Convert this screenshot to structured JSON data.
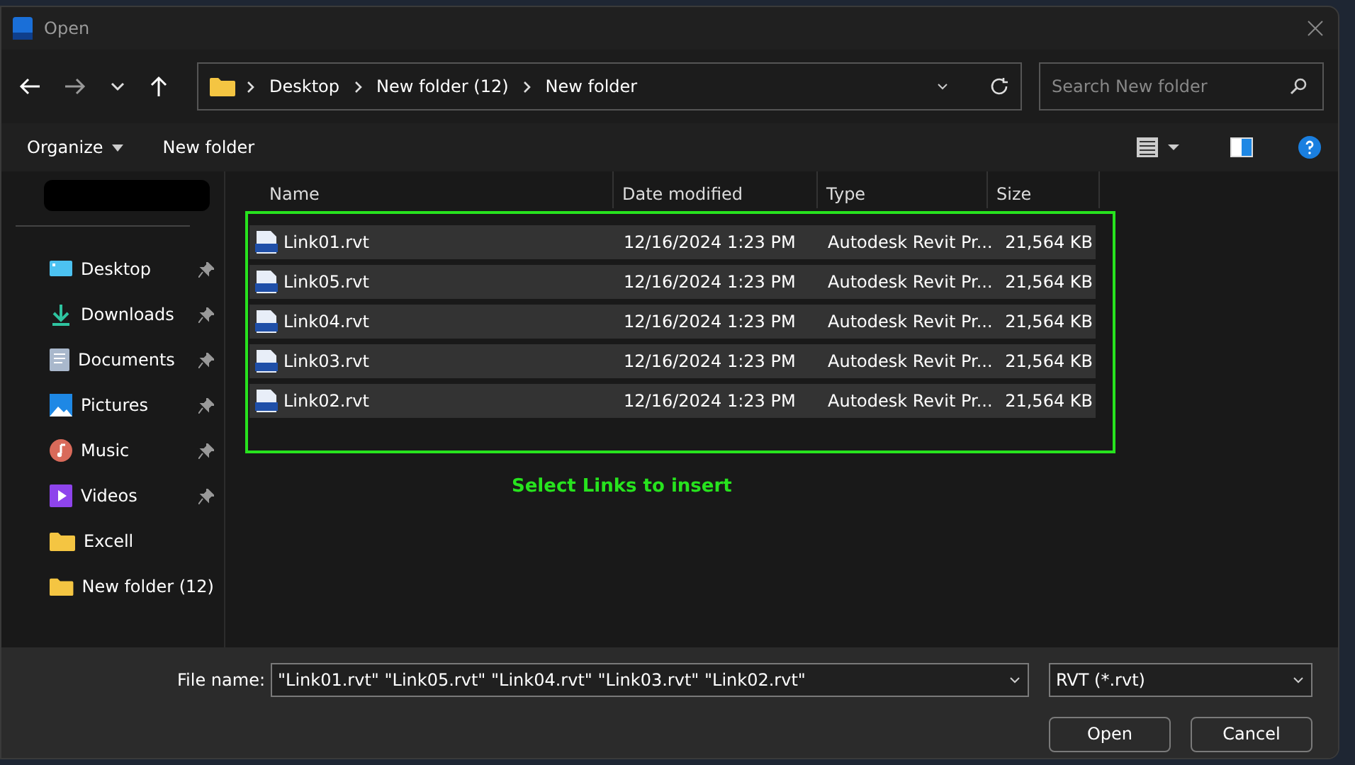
{
  "window": {
    "title": "Open"
  },
  "nav": {
    "path": [
      "Desktop",
      "New folder (12)",
      "New folder"
    ],
    "search": {
      "placeholder": "Search New folder"
    }
  },
  "toolbar": {
    "organize": "Organize",
    "new_folder": "New folder"
  },
  "sidebar": {
    "items": [
      {
        "label": "Desktop",
        "kind": "desktop",
        "pinned": true
      },
      {
        "label": "Downloads",
        "kind": "downloads",
        "pinned": true
      },
      {
        "label": "Documents",
        "kind": "documents",
        "pinned": true
      },
      {
        "label": "Pictures",
        "kind": "pictures",
        "pinned": true
      },
      {
        "label": "Music",
        "kind": "music",
        "pinned": true
      },
      {
        "label": "Videos",
        "kind": "videos",
        "pinned": true
      },
      {
        "label": "Excell",
        "kind": "folder",
        "pinned": false
      },
      {
        "label": "New folder (12)",
        "kind": "folder",
        "pinned": false
      }
    ]
  },
  "table": {
    "columns": [
      "Name",
      "Date modified",
      "Type",
      "Size"
    ],
    "rows": [
      {
        "name": "Link01.rvt",
        "date": "12/16/2024 1:23 PM",
        "type": "Autodesk Revit Pr...",
        "size": "21,564 KB",
        "selected": true
      },
      {
        "name": "Link05.rvt",
        "date": "12/16/2024 1:23 PM",
        "type": "Autodesk Revit Pr...",
        "size": "21,564 KB",
        "selected": true
      },
      {
        "name": "Link04.rvt",
        "date": "12/16/2024 1:23 PM",
        "type": "Autodesk Revit Pr...",
        "size": "21,564 KB",
        "selected": true
      },
      {
        "name": "Link03.rvt",
        "date": "12/16/2024 1:23 PM",
        "type": "Autodesk Revit Pr...",
        "size": "21,564 KB",
        "selected": true
      },
      {
        "name": "Link02.rvt",
        "date": "12/16/2024 1:23 PM",
        "type": "Autodesk Revit Pr...",
        "size": "21,564 KB",
        "selected": true
      }
    ]
  },
  "annotation": "Select Links to insert",
  "footer": {
    "file_name_label": "File name:",
    "file_name": "\"Link01.rvt\" \"Link05.rvt\" \"Link04.rvt\" \"Link03.rvt\" \"Link02.rvt\"",
    "file_type": "RVT (*.rvt)",
    "buttons": [
      "Open",
      "Cancel"
    ]
  }
}
